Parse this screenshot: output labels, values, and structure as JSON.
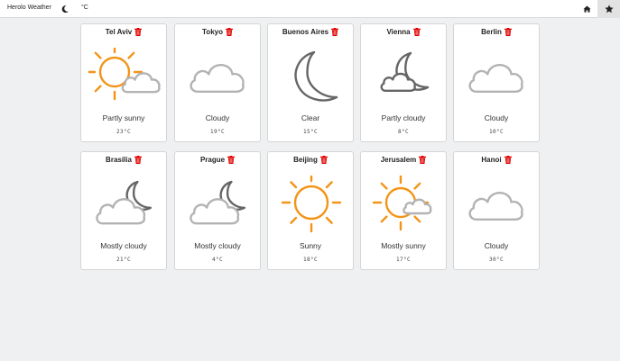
{
  "navbar": {
    "brand": "Herolo Weather",
    "theme_icon": "moon-icon",
    "unit_label": "°C",
    "home_icon": "home-icon",
    "favorites_icon": "star-icon"
  },
  "colors": {
    "sun": "#f39417",
    "cloud": "#b3b3b3",
    "moon": "#666666",
    "delete": "#e00000"
  },
  "cities": [
    {
      "name": "Tel Aviv",
      "condition": "Partly sunny",
      "temp": "23°C",
      "icon": "partly-sunny-icon"
    },
    {
      "name": "Tokyo",
      "condition": "Cloudy",
      "temp": "19°C",
      "icon": "cloud-icon"
    },
    {
      "name": "Buenos Aires",
      "condition": "Clear",
      "temp": "15°C",
      "icon": "clear-night-icon"
    },
    {
      "name": "Vienna",
      "condition": "Partly cloudy",
      "temp": "8°C",
      "icon": "partly-cloudy-night-icon"
    },
    {
      "name": "Berlin",
      "condition": "Cloudy",
      "temp": "10°C",
      "icon": "cloud-icon"
    },
    {
      "name": "Brasilia",
      "condition": "Mostly cloudy",
      "temp": "21°C",
      "icon": "mostly-cloudy-night-icon"
    },
    {
      "name": "Prague",
      "condition": "Mostly cloudy",
      "temp": "4°C",
      "icon": "mostly-cloudy-night-icon"
    },
    {
      "name": "Beijing",
      "condition": "Sunny",
      "temp": "18°C",
      "icon": "sun-icon"
    },
    {
      "name": "Jerusalem",
      "condition": "Mostly sunny",
      "temp": "17°C",
      "icon": "mostly-sunny-icon"
    },
    {
      "name": "Hanoi",
      "condition": "Cloudy",
      "temp": "30°C",
      "icon": "cloud-icon"
    }
  ]
}
